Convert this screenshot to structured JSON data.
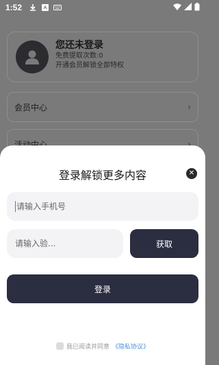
{
  "status_bar": {
    "time": "1:52"
  },
  "profile": {
    "title": "您还未登录",
    "free_count": "免费提取次数:0",
    "subtitle": "开通会员解锁全部特权"
  },
  "menu": [
    {
      "label": "会员中心"
    },
    {
      "label": "活动中心"
    }
  ],
  "login_sheet": {
    "title": "登录解锁更多内容",
    "phone_placeholder": "请输入手机号",
    "code_placeholder": "请输入验...",
    "get_code_label": "获取",
    "login_label": "登录",
    "agree_text": "我已阅读并同意",
    "privacy_link": "《隐私协议》"
  },
  "colors": {
    "accent": "#2b2d40",
    "link": "#4a8fd8",
    "overlay": "#7a7a7a"
  }
}
